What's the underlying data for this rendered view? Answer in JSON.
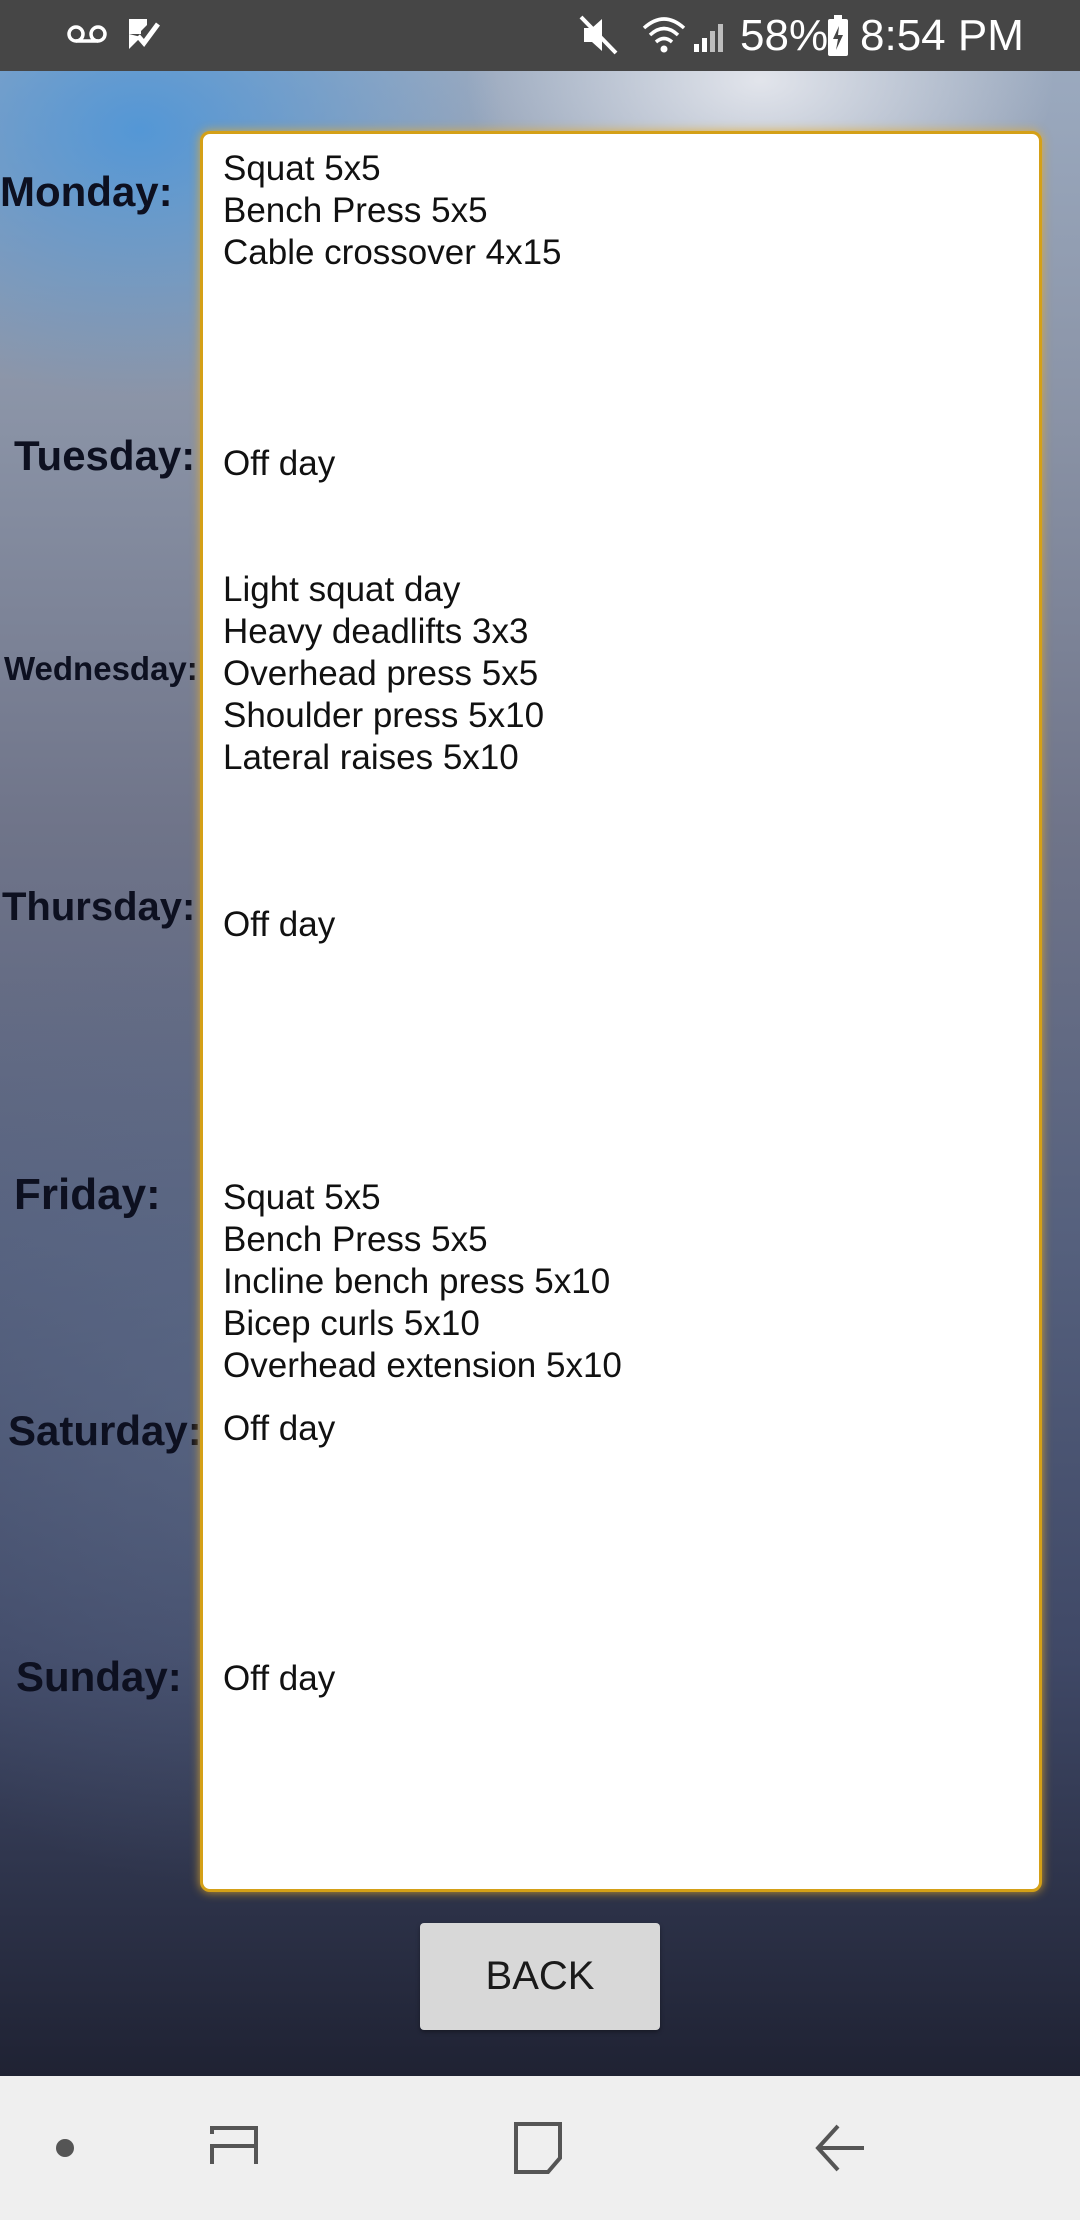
{
  "status_bar": {
    "battery_percent": "58%",
    "time": "8:54 PM",
    "icons": [
      "voicemail-icon",
      "task-check-icon",
      "mute-icon",
      "wifi-icon",
      "signal-icon",
      "battery-icon"
    ]
  },
  "schedule": {
    "days": [
      {
        "label": "Monday:",
        "exercises": [
          "Squat 5x5",
          "Bench Press 5x5",
          "Cable crossover 4x15"
        ]
      },
      {
        "label": "Tuesday:",
        "exercises": [
          "Off day"
        ]
      },
      {
        "label": "Wednesday:",
        "exercises": [
          "Light squat day",
          "Heavy deadlifts 3x3",
          "Overhead press 5x5",
          "Shoulder press 5x10",
          "Lateral raises 5x10"
        ]
      },
      {
        "label": "Thursday:",
        "exercises": [
          "Off day"
        ]
      },
      {
        "label": "Friday:",
        "exercises": [
          "Squat 5x5",
          "Bench Press 5x5",
          "Incline bench press 5x10",
          "Bicep curls 5x10",
          "Overhead extension 5x10"
        ]
      },
      {
        "label": "Saturday:",
        "exercises": [
          "Off day"
        ]
      },
      {
        "label": "Sunday:",
        "exercises": [
          "Off day"
        ]
      }
    ]
  },
  "actions": {
    "back_label": "BACK"
  },
  "nav_bar": {
    "icons": [
      "dot-icon",
      "recent-apps-icon",
      "home-icon",
      "back-icon"
    ]
  },
  "colors": {
    "status_bar_bg": "#464646",
    "panel_border": "#d4a017",
    "nav_bar_bg": "#efefef",
    "button_bg": "#d8d8d8"
  }
}
